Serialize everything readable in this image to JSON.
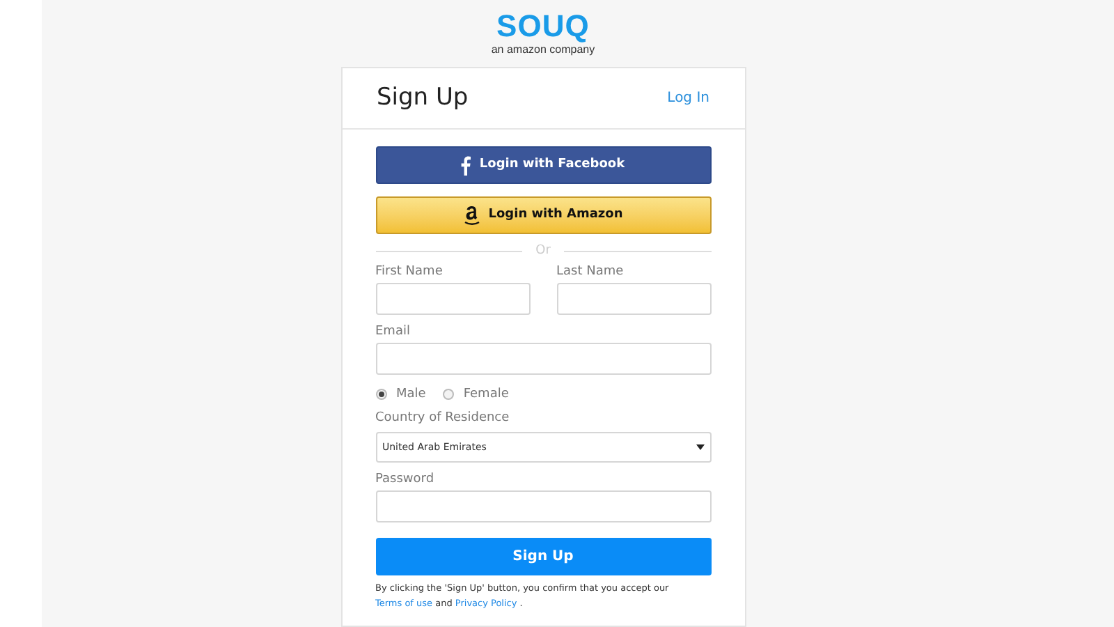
{
  "logo": {
    "brand": "SOUQ",
    "tagline": "an amazon company"
  },
  "header": {
    "title": "Sign Up",
    "login_link": "Log In"
  },
  "social_buttons": [
    {
      "kind": "facebook",
      "label": "Login with Facebook"
    },
    {
      "kind": "amazon",
      "label": "Login with Amazon"
    }
  ],
  "divider": "Or",
  "fields": {
    "first_name": {
      "label": "First Name"
    },
    "last_name": {
      "label": "Last Name"
    },
    "email": {
      "label": "Email"
    }
  },
  "gender": [
    {
      "label": "Male",
      "selected": true
    },
    {
      "label": "Female",
      "selected": false
    }
  ],
  "country": {
    "label": "Country of Residence",
    "value": "United Arab Emirates"
  },
  "password": {
    "label": "Password"
  },
  "submit": "Sign Up",
  "legal": {
    "before": "By clicking the 'Sign Up' button, you confirm that you accept our",
    "terms": "Terms of use",
    "middle": "and",
    "privacy": "Privacy Policy",
    "after": "."
  }
}
